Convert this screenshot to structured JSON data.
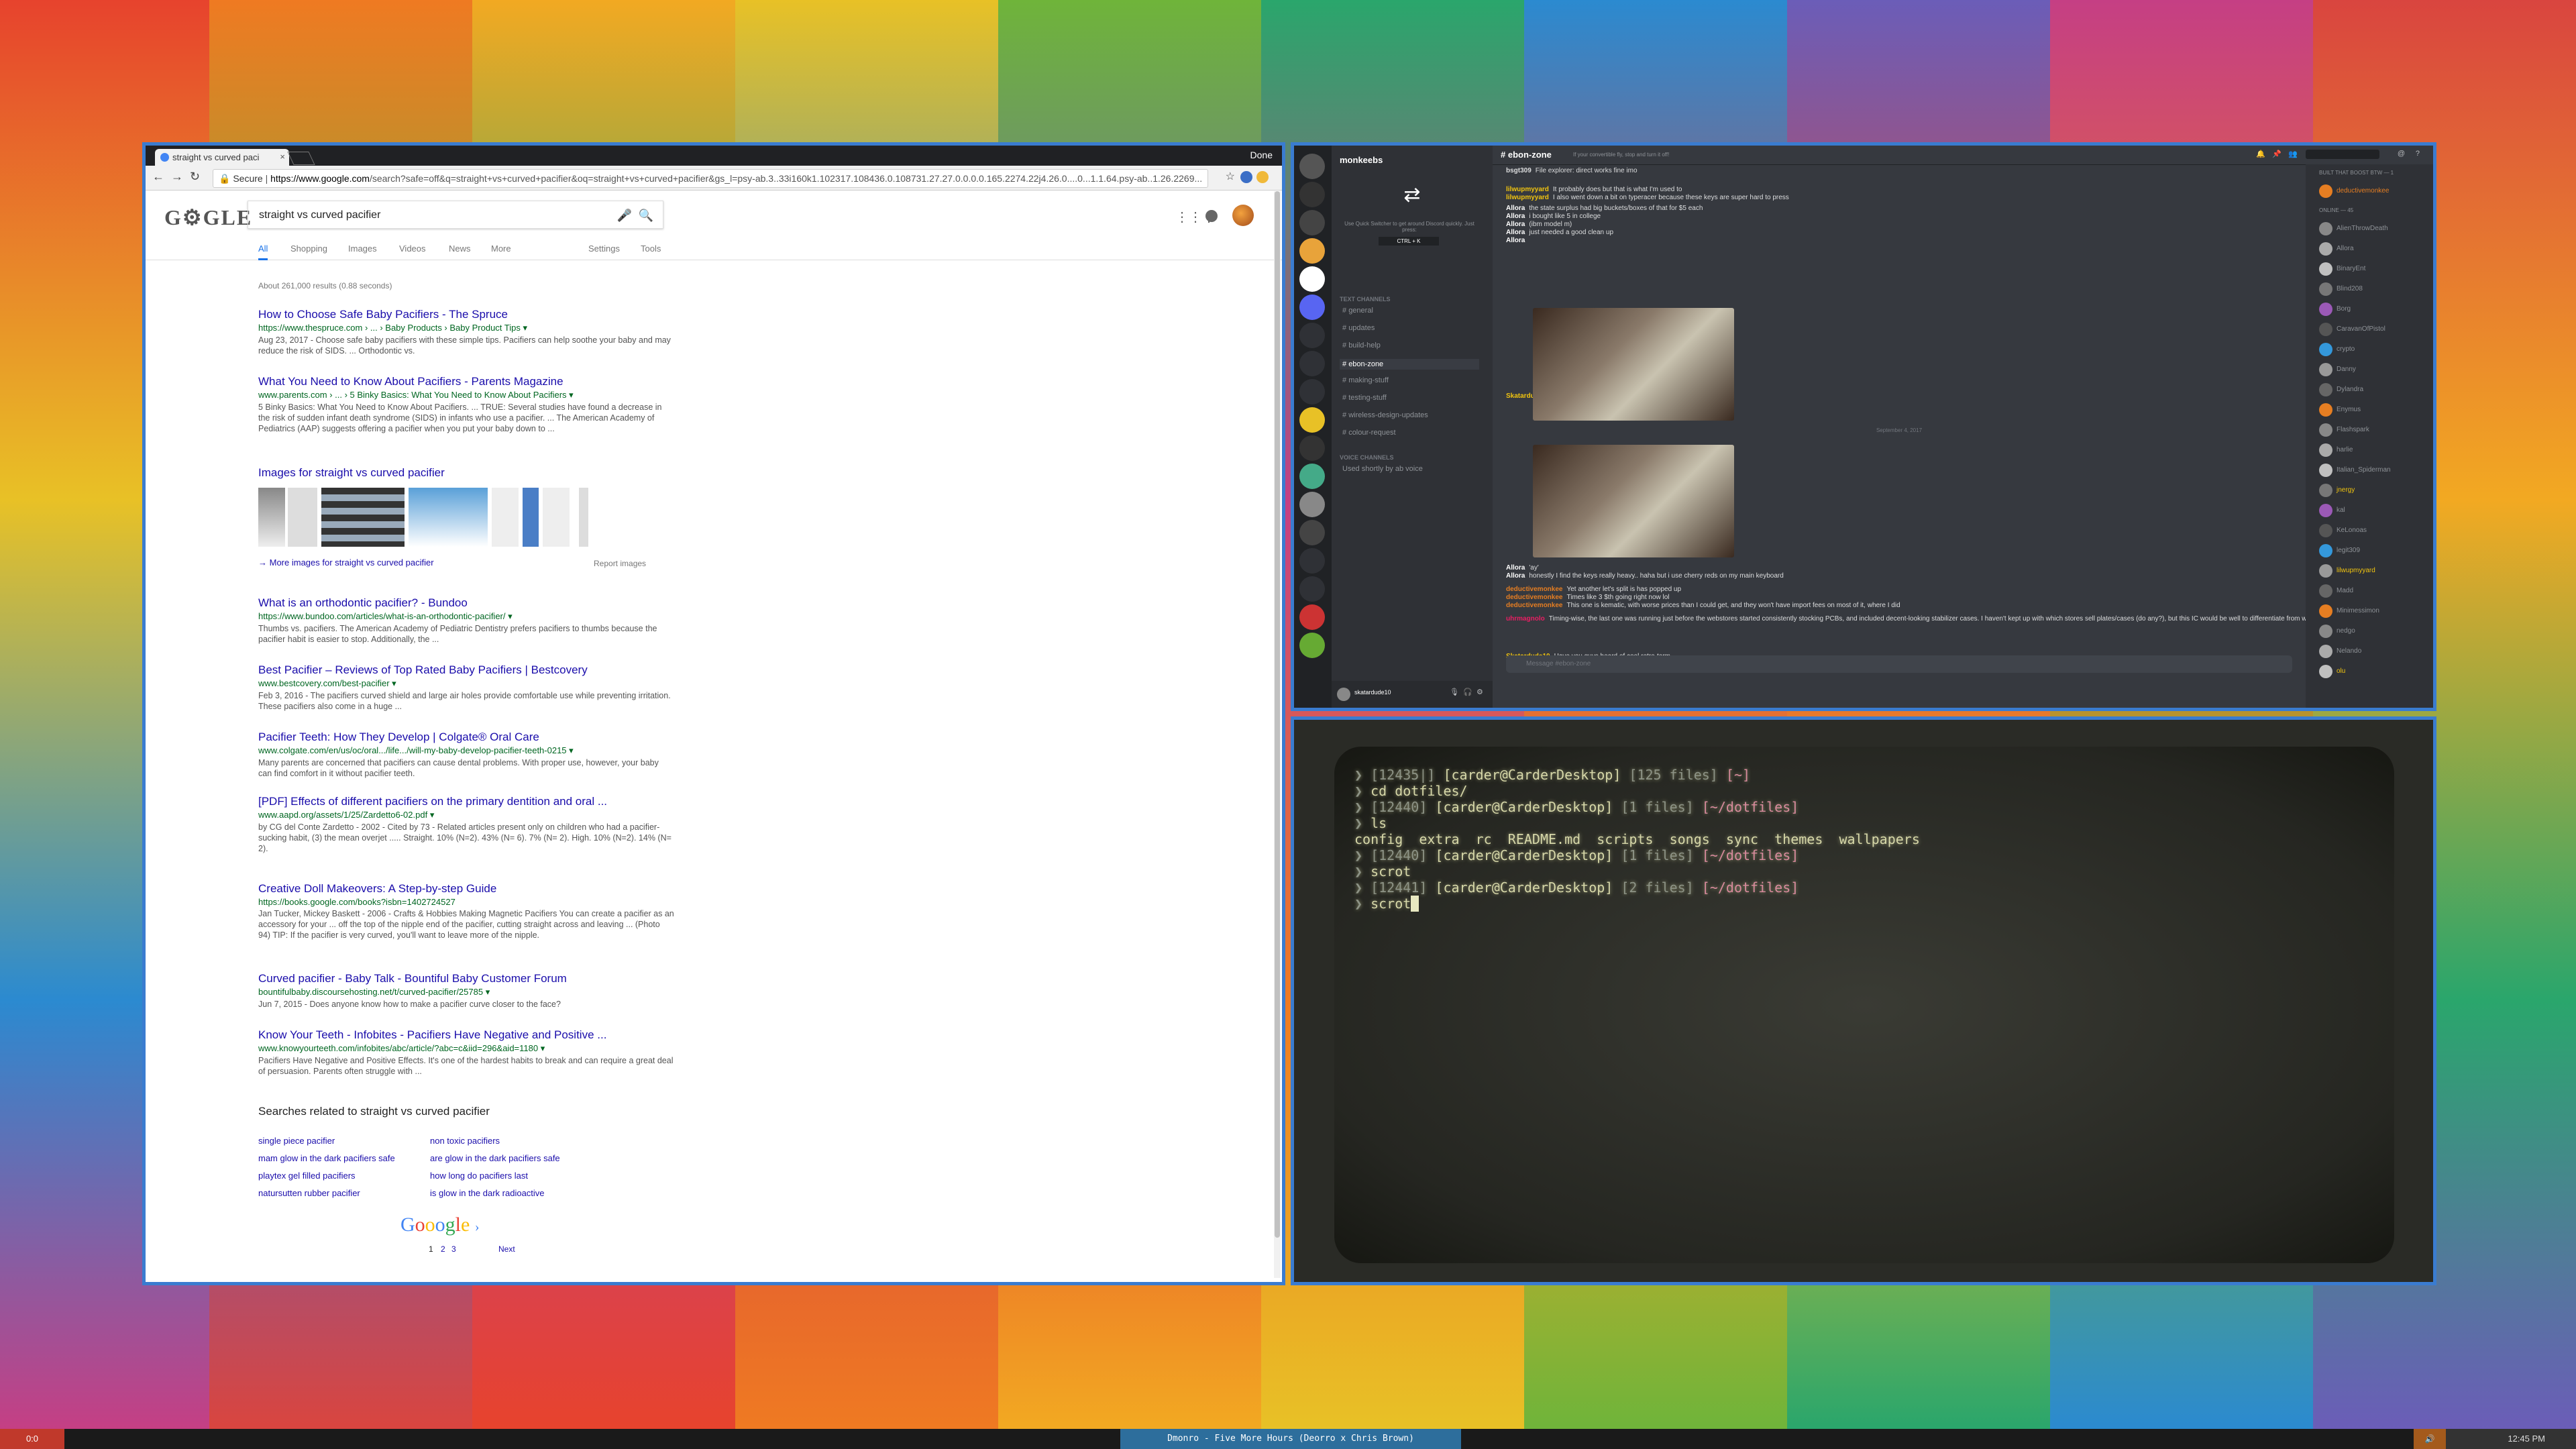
{
  "browser": {
    "tab_title": "straight vs curved paci",
    "done_label": "Done",
    "secure_label": "Secure",
    "url_host": "https://www.google.com",
    "url_path": "/search?safe=off&q=straight+vs+curved+pacifier&oq=straight+vs+curved+pacifier&gs_l=psy-ab.3..33i160k1.102317.108436.0.108731.27.27.0.0.0.0.165.2274.22j4.26.0....0...1.1.64.psy-ab..1.26.2269...",
    "logo_text": "G⚙GLE",
    "search_query": "straight vs curved pacifier",
    "tabs": [
      "All",
      "Shopping",
      "Images",
      "Videos",
      "News",
      "More",
      "Settings",
      "Tools"
    ],
    "stats": "About 261,000 results (0.88 seconds)",
    "results": [
      {
        "title": "How to Choose Safe Baby Pacifiers - The Spruce",
        "url": "https://www.thespruce.com › ... › Baby Products › Baby Product Tips ▾",
        "snippet": "Aug 23, 2017 - Choose safe baby pacifiers with these simple tips. Pacifiers can help soothe your baby and may reduce the risk of SIDS. ... Orthodontic vs."
      },
      {
        "title": "What You Need to Know About Pacifiers - Parents Magazine",
        "url": "www.parents.com › ... › 5 Binky Basics: What You Need to Know About Pacifiers ▾",
        "snippet": "5 Binky Basics: What You Need to Know About Pacifiers. ... TRUE: Several studies have found a decrease in the risk of sudden infant death syndrome (SIDS) in infants who use a pacifier. ... The American Academy of Pediatrics (AAP) suggests offering a pacifier when you put your baby down to ..."
      },
      {
        "title": "What is an orthodontic pacifier? - Bundoo",
        "url": "https://www.bundoo.com/articles/what-is-an-orthodontic-pacifier/ ▾",
        "snippet": "Thumbs vs. pacifiers. The American Academy of Pediatric Dentistry prefers pacifiers to thumbs because the pacifier habit is easier to stop. Additionally, the ..."
      },
      {
        "title": "Best Pacifier – Reviews of Top Rated Baby Pacifiers | Bestcovery",
        "url": "www.bestcovery.com/best-pacifier ▾",
        "snippet": "Feb 3, 2016 - The pacifiers curved shield and large air holes provide comfortable use while preventing irritation. These pacifiers also come in a huge ..."
      },
      {
        "title": "Pacifier Teeth: How They Develop | Colgate® Oral Care",
        "url": "www.colgate.com/en/us/oc/oral.../life.../will-my-baby-develop-pacifier-teeth-0215 ▾",
        "snippet": "Many parents are concerned that pacifiers can cause dental problems. With proper use, however, your baby can find comfort in it without pacifier teeth."
      },
      {
        "title": "[PDF] Effects of different pacifiers on the primary dentition and oral ...",
        "url": "www.aapd.org/assets/1/25/Zardetto6-02.pdf ▾",
        "snippet": "by CG del Conte Zardetto - 2002 - Cited by 73 - Related articles\npresent only on children who had a pacifier-sucking habit, (3) the mean overjet ..... Straight. 10% (N=2). 43% (N= 6). 7% (N= 2). High. 10% (N=2). 14% (N= 2)."
      },
      {
        "title": "Creative Doll Makeovers: A Step-by-step Guide",
        "url": "https://books.google.com/books?isbn=1402724527",
        "snippet": "Jan Tucker, Mickey Baskett - 2006 - Crafts & Hobbies\nMaking Magnetic Pacifiers You can create a pacifier as an accessory for your ... off the top of the nipple end of the pacifier, cutting straight across and leaving ... (Photo 94) TIP: If the pacifier is very curved, you'll want to leave more of the nipple."
      },
      {
        "title": "Curved pacifier - Baby Talk - Bountiful Baby Customer Forum",
        "url": "bountifulbaby.discoursehosting.net/t/curved-pacifier/25785 ▾",
        "snippet": "Jun 7, 2015 - Does anyone know how to make a pacifier curve closer to the face?"
      },
      {
        "title": "Know Your Teeth - Infobites - Pacifiers Have Negative and Positive ...",
        "url": "www.knowyourteeth.com/infobites/abc/article/?abc=c&iid=296&aid=1180 ▾",
        "snippet": "Pacifiers Have Negative and Positive Effects. It's one of the hardest habits to break and can require a great deal of persuasion. Parents often struggle with ..."
      }
    ],
    "images_heading": "Images for straight vs curved pacifier",
    "more_images": "More images for straight vs curved pacifier",
    "report_images": "Report images",
    "related_heading": "Searches related to straight vs curved pacifier",
    "related": [
      [
        "single piece pacifier",
        "non toxic pacifiers"
      ],
      [
        "mam glow in the dark pacifiers safe",
        "are glow in the dark pacifiers safe"
      ],
      [
        "playtex gel filled pacifiers",
        "how long do pacifiers last"
      ],
      [
        "natursutten rubber pacifier",
        "is glow in the dark radioactive"
      ]
    ],
    "pager_logo": "Gooogle",
    "pager": [
      "1",
      "2",
      "3",
      "Next"
    ]
  },
  "discord": {
    "server_name": "monkeebs",
    "channel_name": "ebon-zone",
    "topic": "If your convertible fly, stop and turn it off!",
    "switcher_hint": "Use Quick Switcher to get around Discord quickly. Just press:",
    "switcher_key": "CTRL + K",
    "categories": [
      "TEXT CHANNELS",
      "VOICE CHANNELS"
    ],
    "channels": [
      "general",
      "updates",
      "build-help",
      "ebon-zone",
      "making-stuff",
      "testing-stuff",
      "wireless-design-updates",
      "colour-request"
    ],
    "voice_channel": "Used shortly by ab voice",
    "messages": [
      {
        "name": "bsgt309",
        "text": "File explorer: direct works fine imo"
      },
      {
        "name": "lilwupmyyard",
        "text": "It probably does but that is what I'm used to"
      },
      {
        "name": "lilwupmyyard",
        "text": "I also went down a bit on typeracer because these keys are super hard to press"
      },
      {
        "name": "Allora",
        "text": "the state surplus had big buckets/boxes of that for $5 each"
      },
      {
        "name": "Allora",
        "text": "i bought like 5 in college"
      },
      {
        "name": "Allora",
        "text": "(ibm model m)"
      },
      {
        "name": "Allora",
        "text": "just needed a good clean up"
      },
      {
        "name": "Allora",
        "text": ""
      },
      {
        "name": "Skatardude10",
        "text": "Since we are doing this..."
      },
      {
        "name": "Allora",
        "text": "'ay'"
      },
      {
        "name": "Allora",
        "text": "honestly I find the keys really heavy.. haha but i use cherry reds on my main keyboard"
      },
      {
        "name": "deductivemonkee",
        "text": "Yet another let's split is has popped up"
      },
      {
        "name": "deductivemonkee",
        "text": "Times like 3 $th going right now lol"
      },
      {
        "name": "deductivemonkee",
        "text": "This one is kematic, with worse prices than I could get, and they won't have import fees on most of it, where I did"
      },
      {
        "name": "uhrmagnolo",
        "text": "Timing-wise, the last one was running just before the webstores started consistently stocking PCBs, and included decent-looking stabilizer cases. I haven't kept up with which stores sell plates/cases (do any?), but this IC would be well to differentiate from what's already available now..."
      },
      {
        "name": "Skatardude10",
        "text": "Have you guys heard of cool retro-term"
      }
    ],
    "date_divider": "September 4, 2017",
    "input_placeholder": "Message #ebon-zone",
    "user_name": "skatardude10",
    "members_header": "BUILT THAT BOOST BTW — 1",
    "online_header": "ONLINE — 45",
    "members": [
      "deductivemonkee",
      "AlienThrowDeath",
      "Allora",
      "BinaryEnt",
      "Blind208",
      "Borg",
      "CaravanOfPistol",
      "crypto",
      "Danny",
      "Dylandra",
      "Enymus",
      "Flashspark",
      "harlie",
      "Italian_Spiderman",
      "jnergy",
      "kal",
      "KeLonoas",
      "legit309",
      "lilwupmyyard",
      "Madd",
      "Minimessimon",
      "nedgo",
      "Nelando",
      "olu"
    ]
  },
  "terminal": {
    "lines": [
      {
        "p": "❯ [12435|] ",
        "u": "[carder@CarderDesktop]",
        "m": " [125 files] ",
        "d": "[~]"
      },
      {
        "p": "❯ ",
        "c": "cd dotfiles/"
      },
      {
        "p": "❯ [12440] ",
        "u": "[carder@CarderDesktop]",
        "m": " [1 files] ",
        "d": "[~/dotfiles]"
      },
      {
        "p": "❯ ",
        "c": "ls"
      },
      {
        "c": "config  extra  rc  README.md  scripts  songs  sync  themes  wallpapers"
      },
      {
        "p": "❯ [12440] ",
        "u": "[carder@CarderDesktop]",
        "m": " [1 files] ",
        "d": "[~/dotfiles]"
      },
      {
        "p": "❯ ",
        "c": "scrot"
      },
      {
        "p": "❯ [12441] ",
        "u": "[carder@CarderDesktop]",
        "m": " [2 files] ",
        "d": "[~/dotfiles]"
      },
      {
        "p": "❯ ",
        "c": "scrot"
      }
    ]
  },
  "statusbar": {
    "left": "0:0",
    "media": "Dmonro - Five More Hours (Deorro x Chris Brown)",
    "volume_icon": "speaker-icon",
    "clock": "12:45 PM"
  }
}
